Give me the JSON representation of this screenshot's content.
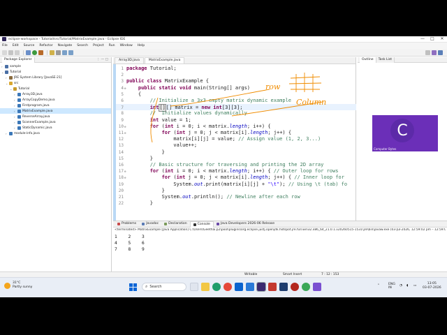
{
  "window": {
    "title": "eclipse-workspace - Tutorial/src/Tutorial/MatrixExample.java - Eclipse IDE",
    "controls": [
      "—",
      "□",
      "✕"
    ]
  },
  "menu": [
    "File",
    "Edit",
    "Source",
    "Refactor",
    "Navigate",
    "Search",
    "Project",
    "Run",
    "Window",
    "Help"
  ],
  "package_explorer": {
    "title": "Package Explorer",
    "items": [
      {
        "label": "sample",
        "indent": 0,
        "arrow": "›",
        "icon": "project"
      },
      {
        "label": "Tutorial",
        "indent": 0,
        "arrow": "⌄",
        "icon": "project"
      },
      {
        "label": "JRE System Library [JavaSE-21]",
        "indent": 1,
        "arrow": "›",
        "icon": "library"
      },
      {
        "label": "src",
        "indent": 1,
        "arrow": "⌄",
        "icon": "folder"
      },
      {
        "label": "Tutorial",
        "indent": 2,
        "arrow": "⌄",
        "icon": "package"
      },
      {
        "label": "Array3D.java",
        "indent": 3,
        "arrow": "›",
        "icon": "java"
      },
      {
        "label": "ArrayCopyDemo.java",
        "indent": 3,
        "arrow": "›",
        "icon": "java"
      },
      {
        "label": "Firstprogram.java",
        "indent": 3,
        "arrow": "›",
        "icon": "java"
      },
      {
        "label": "MatrixExample.java",
        "indent": 3,
        "arrow": "›",
        "icon": "java",
        "selected": true
      },
      {
        "label": "ReverseArray.java",
        "indent": 3,
        "arrow": "›",
        "icon": "java"
      },
      {
        "label": "ScannerExample.java",
        "indent": 3,
        "arrow": "›",
        "icon": "java"
      },
      {
        "label": "StaticDynamic.java",
        "indent": 3,
        "arrow": "›",
        "icon": "java"
      },
      {
        "label": "module-info.java",
        "indent": 1,
        "arrow": "›",
        "icon": "java"
      }
    ]
  },
  "editor": {
    "tabs": [
      "Array3D.java",
      "MatrixExample.java"
    ],
    "active_tab": 1,
    "current_line": 7,
    "lines": [
      {
        "n": 1,
        "html": "<span class=\"kw\">package</span> Tutorial;"
      },
      {
        "n": 2,
        "html": ""
      },
      {
        "n": 3,
        "html": "<span class=\"kw\">public class</span> MatrixExample {"
      },
      {
        "n": 4,
        "fold": "⊖",
        "html": "    <span class=\"kw\">public static void</span> main(String[] args)"
      },
      {
        "n": 5,
        "html": "    {"
      },
      {
        "n": 6,
        "html": "        <span class=\"cm\">// Initialize a 3x3 empty matrix dynamic example</span>"
      },
      {
        "n": 7,
        "html": "        <span class=\"kw\">int</span><span class=\"cursorbox\">[]</span>[] matrix = <span class=\"kw\">new int</span>[3][3];"
      },
      {
        "n": 8,
        "html": "        <span class=\"cm\">//  Initialize values dynamically</span>"
      },
      {
        "n": 9,
        "html": "        <span class=\"kw\">int</span> value = 1;"
      },
      {
        "n": 10,
        "fold": "⊖",
        "html": "        <span class=\"kw\">for</span> (<span class=\"kw\">int</span> i = 0; i < matrix.<span class=\"fld\">length</span>; i++) {"
      },
      {
        "n": 11,
        "fold": "⊖",
        "html": "            <span class=\"kw\">for</span> (<span class=\"kw\">int</span> j = 0; j < matrix[i].<span class=\"fld\">length</span>; j++) {"
      },
      {
        "n": 12,
        "html": "                matrix[i][j] = value; <span class=\"cm\">// Assign value (1, 2, 3...)</span>"
      },
      {
        "n": 13,
        "html": "                value++;"
      },
      {
        "n": 14,
        "html": "            }"
      },
      {
        "n": 15,
        "html": "        }"
      },
      {
        "n": 16,
        "html": "        <span class=\"cm\">// Basic structure for traversing and printing the 2D array</span>"
      },
      {
        "n": 17,
        "fold": "⊖",
        "html": "        <span class=\"kw\">for</span> (<span class=\"kw\">int</span> i = 0; i < matrix.<span class=\"fld\">length</span>; i++) { <span class=\"cm\">// Outer loop for rows</span>"
      },
      {
        "n": 18,
        "fold": "⊖",
        "html": "            <span class=\"kw\">for</span> (<span class=\"kw\">int</span> j = 0; j < matrix[i].<span class=\"fld\">length</span>; j++) { <span class=\"cm\">// Inner loop for</span>"
      },
      {
        "n": 19,
        "html": "                System.<span class=\"fld\">out</span>.print(matrix[i][j] + <span class=\"st\">\"\\t\"</span>); <span class=\"cm\">// Using \\t (tab) fo</span>"
      },
      {
        "n": 20,
        "html": "            }"
      },
      {
        "n": 21,
        "html": "            System.<span class=\"fld\">out</span>.println(); <span class=\"cm\">// Newline after each row</span>"
      },
      {
        "n": 22,
        "html": "        }"
      }
    ]
  },
  "annotations": {
    "row": "row",
    "column": "Column"
  },
  "outline": {
    "tabs": [
      "Outline",
      "Task List"
    ],
    "webcam_initial": "C",
    "webcam_caption": "Computer Bytes"
  },
  "console": {
    "tabs": [
      "Problems",
      "Javadoc",
      "Declaration",
      "Console",
      "Java Developers 2026-06 Release"
    ],
    "active_tab": 3,
    "terminated": "<terminated> MatrixExample [Java Application] C:\\Users\\Geethai.p2\\pool\\plugins\\org.eclipse.justj.openjdk.hotspot.jre.full.win32.x86_64_21.0.1.v20260515-1531\\jre\\bin\\javaw.exe  (03-Jul-2026, 12:59:02 pm – 12:59:02 pm)",
    "output": [
      [
        "1",
        "2",
        "3"
      ],
      [
        "4",
        "5",
        "6"
      ],
      [
        "7",
        "8",
        "9"
      ]
    ]
  },
  "statusbar": {
    "writable": "Writable",
    "insert": "Smart Insert",
    "position": "7 : 12 : 153"
  },
  "taskbar": {
    "temp": "31°C",
    "weather": "Partly sunny",
    "search": "Search",
    "lang1": "ENG",
    "lang2": "IN",
    "time": "13:05",
    "date": "03-07-2026"
  }
}
